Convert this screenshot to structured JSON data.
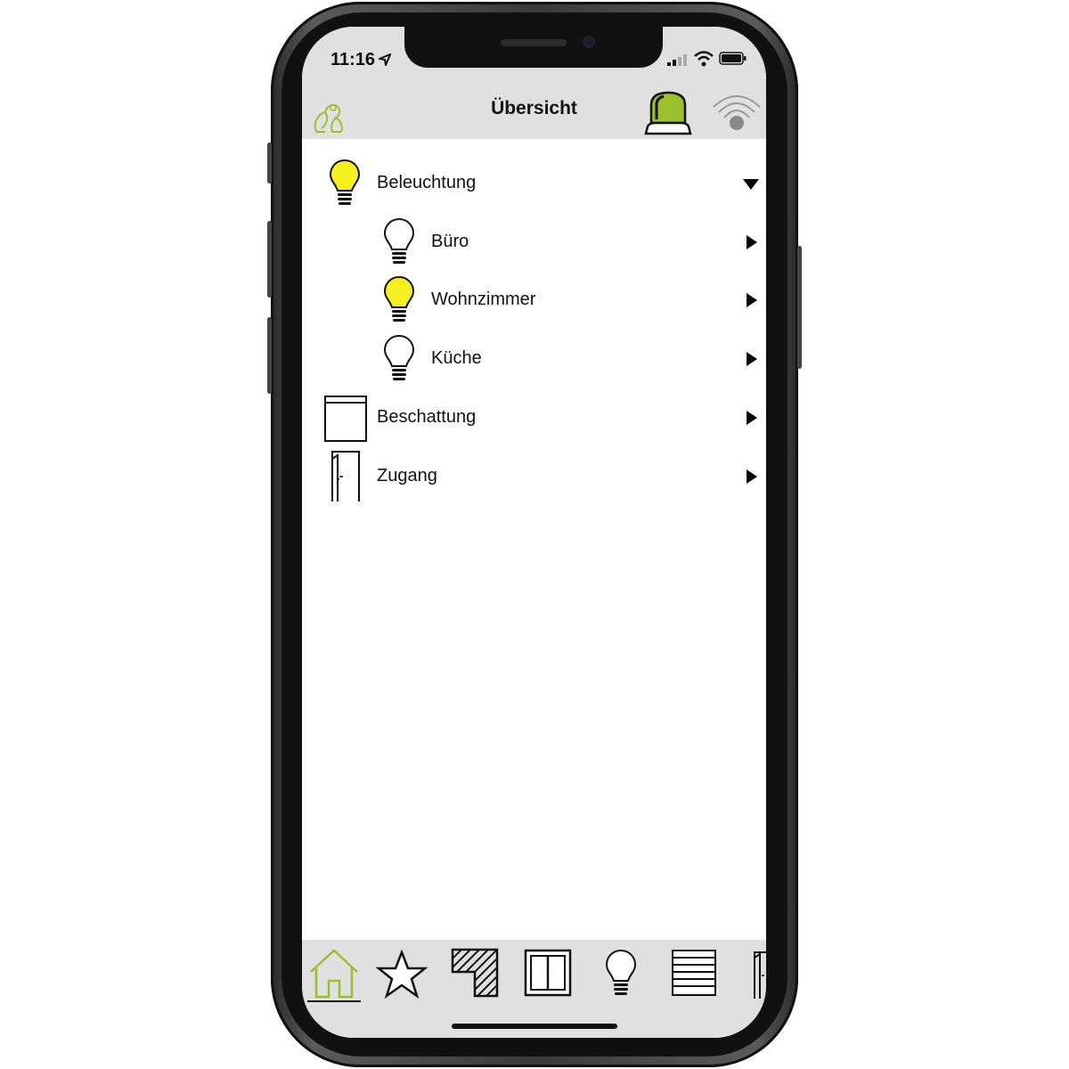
{
  "status_bar": {
    "time": "11:16"
  },
  "nav_bar": {
    "title": "Übersicht"
  },
  "colors": {
    "accent_green": "#9cbf2b",
    "bulb_yellow": "#f5f01e",
    "bar_gray": "#e0e0e0"
  },
  "menu": [
    {
      "label": "Beleuchtung",
      "icon": "bulb-on-icon",
      "expanded": true
    },
    {
      "label": "Büro",
      "icon": "bulb-off-icon",
      "level": 2
    },
    {
      "label": "Wohnzimmer",
      "icon": "bulb-on-icon",
      "level": 2
    },
    {
      "label": "Küche",
      "icon": "bulb-off-icon",
      "level": 2
    },
    {
      "label": "Beschattung",
      "icon": "shade-icon"
    },
    {
      "label": "Zugang",
      "icon": "door-icon"
    }
  ],
  "tabs": [
    {
      "icon": "home-icon",
      "selected": true
    },
    {
      "icon": "star-icon"
    },
    {
      "icon": "hatched-square-icon"
    },
    {
      "icon": "window-icon"
    },
    {
      "icon": "bulb-icon"
    },
    {
      "icon": "blinds-icon"
    },
    {
      "icon": "door-icon"
    }
  ]
}
